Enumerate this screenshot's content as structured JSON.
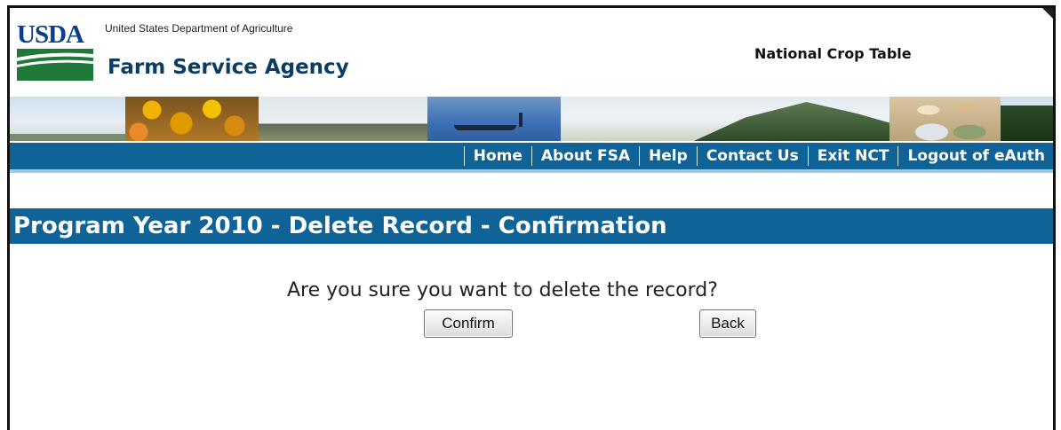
{
  "header": {
    "logo_text": "USDA",
    "department": "United States Department of Agriculture",
    "agency": "Farm Service Agency",
    "app_title": "National Crop Table"
  },
  "nav": {
    "items": [
      {
        "label": "Home"
      },
      {
        "label": "About FSA"
      },
      {
        "label": "Help"
      },
      {
        "label": "Contact Us"
      },
      {
        "label": "Exit NCT"
      },
      {
        "label": "Logout of eAuth"
      }
    ]
  },
  "page": {
    "heading": "Program Year 2010 - Delete Record - Confirmation",
    "question": "Are you sure you want to delete the record?",
    "confirm_label": "Confirm",
    "back_label": "Back"
  },
  "colors": {
    "nav_bar": "#0f6396",
    "heading_bar": "#0f6396",
    "usda_blue": "#0b3d8f",
    "usda_green": "#1f7a3a"
  }
}
